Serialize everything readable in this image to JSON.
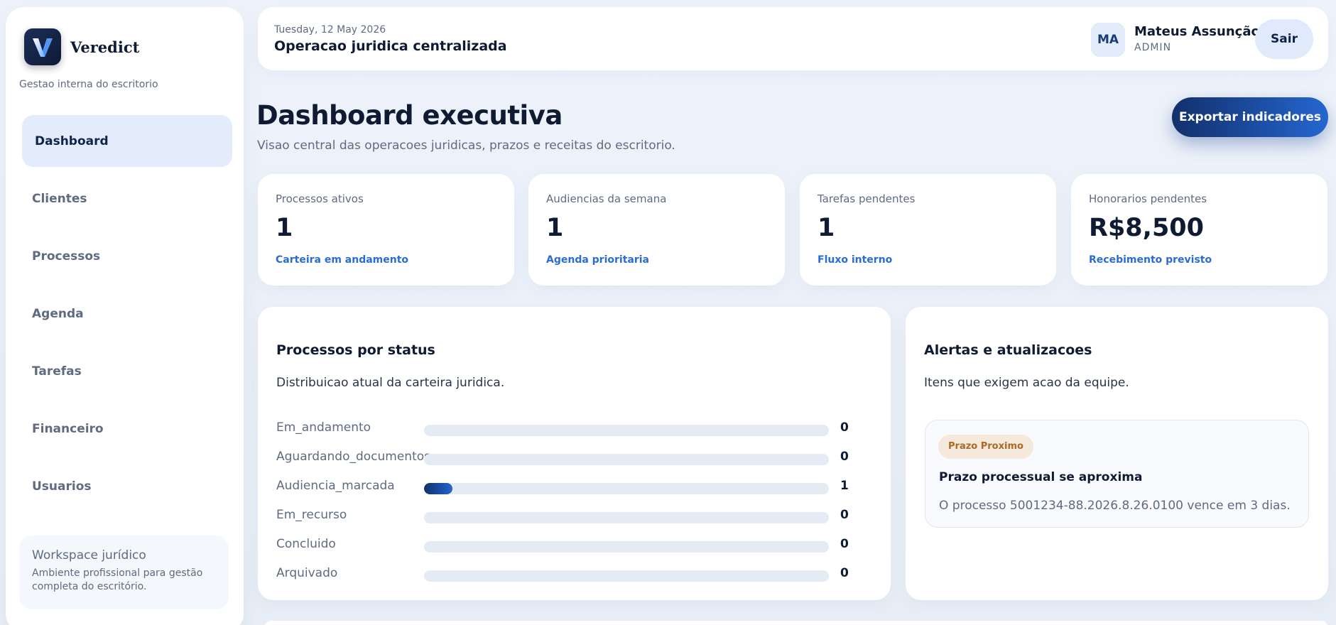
{
  "brand": {
    "name": "Veredict",
    "subtitle": "Gestao interna do escritorio",
    "logo_letter": "V"
  },
  "nav": {
    "items": [
      {
        "label": "Dashboard",
        "active": true
      },
      {
        "label": "Clientes"
      },
      {
        "label": "Processos"
      },
      {
        "label": "Agenda"
      },
      {
        "label": "Tarefas"
      },
      {
        "label": "Financeiro"
      },
      {
        "label": "Usuarios"
      }
    ]
  },
  "workspace": {
    "title": "Workspace jurídico",
    "description": "Ambiente profissional para gestão completa do escritório."
  },
  "topbar": {
    "date": "Tuesday, 12 May 2026",
    "title": "Operacao juridica centralizada",
    "user": {
      "initials": "MA",
      "name": "Mateus Assunção",
      "role": "ADMIN"
    },
    "logout_label": "Sair"
  },
  "header": {
    "title": "Dashboard executiva",
    "subtitle": "Visao central das operacoes juridicas, prazos e receitas do escritorio.",
    "export_label": "Exportar indicadores"
  },
  "kpis": [
    {
      "label": "Processos ativos",
      "value": "1",
      "note": "Carteira em andamento"
    },
    {
      "label": "Audiencias da semana",
      "value": "1",
      "note": "Agenda prioritaria"
    },
    {
      "label": "Tarefas pendentes",
      "value": "1",
      "note": "Fluxo interno"
    },
    {
      "label": "Honorarios pendentes",
      "value": "R$8,500",
      "note": "Recebimento previsto"
    }
  ],
  "status_panel": {
    "title": "Processos por status",
    "subtitle": "Distribuicao atual da carteira juridica.",
    "rows": [
      {
        "label": "Em_andamento",
        "count": "0",
        "fraction": 0
      },
      {
        "label": "Aguardando_documentos",
        "count": "0",
        "fraction": 0
      },
      {
        "label": "Audiencia_marcada",
        "count": "1",
        "fraction": 0.07
      },
      {
        "label": "Em_recurso",
        "count": "0",
        "fraction": 0
      },
      {
        "label": "Concluido",
        "count": "0",
        "fraction": 0
      },
      {
        "label": "Arquivado",
        "count": "0",
        "fraction": 0
      }
    ]
  },
  "alerts_panel": {
    "title": "Alertas e atualizacoes",
    "subtitle": "Itens que exigem acao da equipe.",
    "alert": {
      "badge": "Prazo Proximo",
      "title": "Prazo processual se aproxima",
      "text": "O processo 5001234-88.2026.8.26.0100 vence em 3 dias."
    }
  },
  "colors": {
    "accent": "#2566d0",
    "navy": "#12306b",
    "badge_bg": "#f5e9dc",
    "badge_text": "#a86a25"
  }
}
